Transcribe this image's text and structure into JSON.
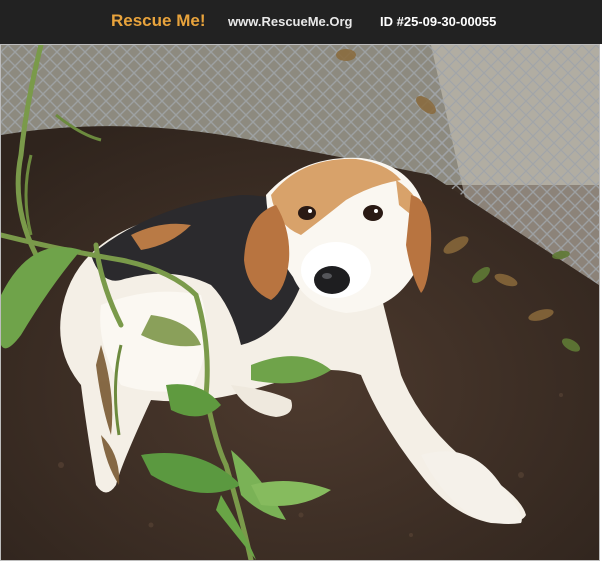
{
  "header": {
    "brand": "Rescue Me!",
    "site": "www.RescueMe.Org",
    "pet_id": "ID #25-09-30-00055"
  },
  "colors": {
    "header_bg": "#222222",
    "brand": "#e8a33c",
    "site_text": "#e8e8e8",
    "id_text": "#ffffff"
  },
  "photo": {
    "subject": "beagle mix dog lying on dirt beside a chain-link fence with green plants"
  }
}
